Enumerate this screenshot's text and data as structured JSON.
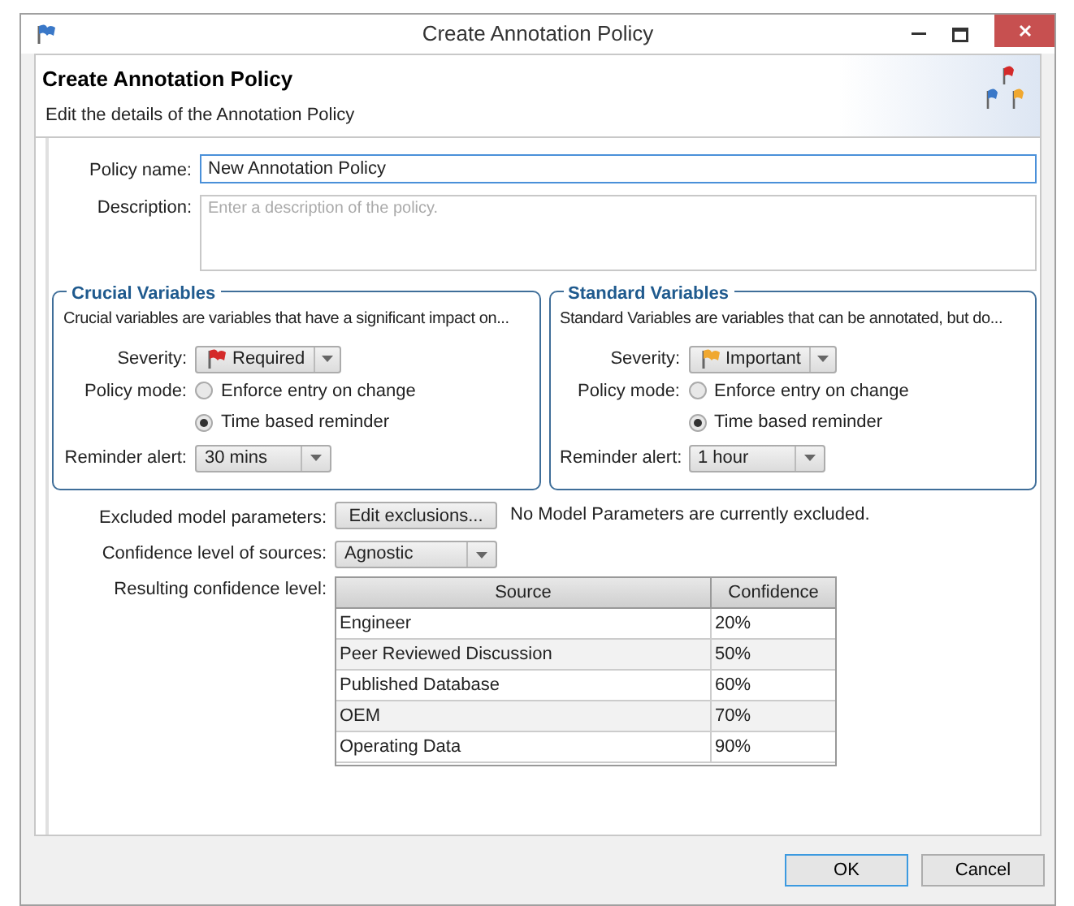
{
  "window": {
    "title": "Create Annotation Policy"
  },
  "header": {
    "title": "Create Annotation Policy",
    "subtitle": "Edit the details of the Annotation Policy"
  },
  "policy_name": {
    "label": "Policy name:",
    "value": "New Annotation Policy"
  },
  "description": {
    "label": "Description:",
    "placeholder": "Enter a description of the policy."
  },
  "groups": [
    {
      "title": "Crucial Variables",
      "text": "Crucial variables are variables that have a significant impact on...",
      "severity_label": "Severity:",
      "severity": "Required",
      "color": "#d42a2a",
      "mode_label": "Policy mode:",
      "modes": [
        {
          "label": "Enforce entry on change",
          "selected": false
        },
        {
          "label": "Time based reminder",
          "selected": true
        }
      ],
      "reminder_label": "Reminder alert:",
      "reminder": "30 mins"
    },
    {
      "title": "Standard Variables",
      "text": "Standard Variables are variables that can be annotated, but do...",
      "severity_label": "Severity:",
      "severity": "Important",
      "color": "#f0a830",
      "mode_label": "Policy mode:",
      "modes": [
        {
          "label": "Enforce entry on change",
          "selected": false
        },
        {
          "label": "Time based reminder",
          "selected": true
        }
      ],
      "reminder_label": "Reminder alert:",
      "reminder": "1 hour"
    }
  ],
  "excluded": {
    "label": "Excluded model parameters:",
    "button": "Edit exclusions...",
    "status": "No Model Parameters are currently excluded."
  },
  "confidence": {
    "label": "Confidence level of sources:",
    "value": "Agnostic"
  },
  "result": {
    "label": "Resulting confidence level:",
    "columns": [
      "Source",
      "Confidence"
    ],
    "rows": [
      [
        "Engineer",
        "20%"
      ],
      [
        "Peer Reviewed Discussion",
        "50%"
      ],
      [
        "Published Database",
        "60%"
      ],
      [
        "OEM",
        "70%"
      ],
      [
        "Operating Data",
        "90%"
      ]
    ]
  },
  "buttons": [
    {
      "label": "OK",
      "default": true
    },
    {
      "label": "Cancel",
      "default": false
    }
  ]
}
